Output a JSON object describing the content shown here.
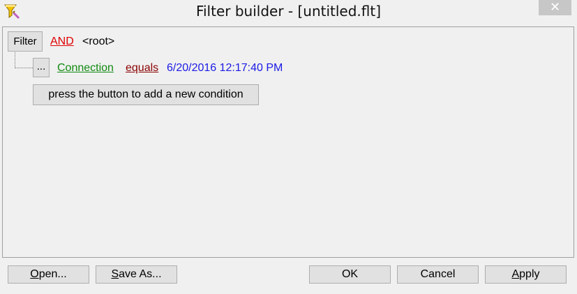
{
  "window": {
    "title": "Filter builder - [untitled.flt]",
    "close_glyph": "✕"
  },
  "filter": {
    "filter_button": "Filter",
    "group_operator": "AND",
    "group_label": "<root>",
    "condition": {
      "menu_button": "...",
      "field": "Connection",
      "operator": "equals",
      "value": "6/20/2016 12:17:40 PM"
    },
    "add_condition_button": "press the button to add a new condition"
  },
  "footer": {
    "open_label": "Open...",
    "save_as_label": "Save As...",
    "ok_label": "OK",
    "cancel_label": "Cancel",
    "apply_label": "Apply"
  },
  "colors": {
    "operator_red": "#e00000",
    "field_green": "#108a10",
    "comparison_darkred": "#8b0000",
    "value_blue": "#1a1ae6"
  },
  "icons": {
    "app": "filter-funnel-icon",
    "close": "close-icon"
  }
}
